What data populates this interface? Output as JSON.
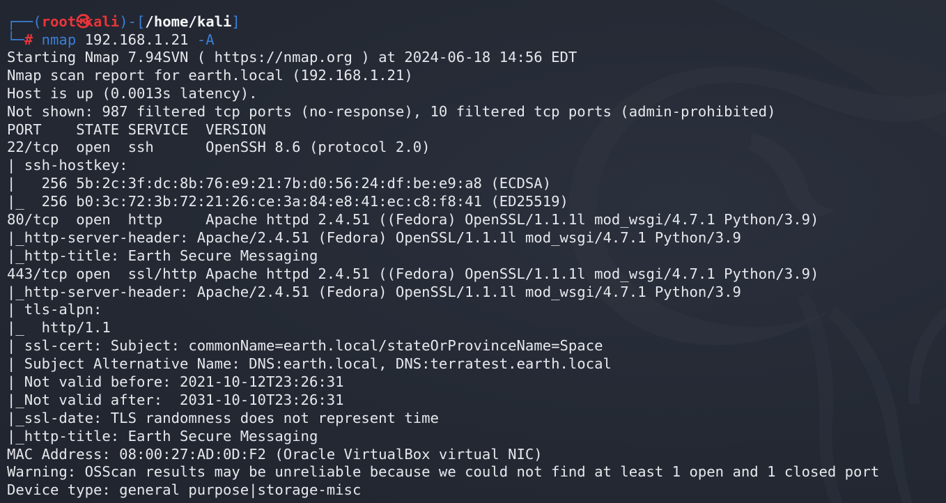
{
  "prompt": {
    "bracket_open_top": "┌──(",
    "user": "root",
    "symbol": "㉿",
    "host": "kali",
    "mid": ")-[",
    "cwd": "/home/kali",
    "bracket_close": "]",
    "corner_bottom": "└─",
    "hash": "#",
    "command": "nmap",
    "target": "192.168.1.21",
    "flag": "-A"
  },
  "output_lines": [
    "Starting Nmap 7.94SVN ( https://nmap.org ) at 2024-06-18 14:56 EDT",
    "Nmap scan report for earth.local (192.168.1.21)",
    "Host is up (0.0013s latency).",
    "Not shown: 987 filtered tcp ports (no-response), 10 filtered tcp ports (admin-prohibited)",
    "PORT    STATE SERVICE  VERSION",
    "22/tcp  open  ssh      OpenSSH 8.6 (protocol 2.0)",
    "| ssh-hostkey: ",
    "|   256 5b:2c:3f:dc:8b:76:e9:21:7b:d0:56:24:df:be:e9:a8 (ECDSA)",
    "|_  256 b0:3c:72:3b:72:21:26:ce:3a:84:e8:41:ec:c8:f8:41 (ED25519)",
    "80/tcp  open  http     Apache httpd 2.4.51 ((Fedora) OpenSSL/1.1.1l mod_wsgi/4.7.1 Python/3.9)",
    "|_http-server-header: Apache/2.4.51 (Fedora) OpenSSL/1.1.1l mod_wsgi/4.7.1 Python/3.9",
    "|_http-title: Earth Secure Messaging",
    "443/tcp open  ssl/http Apache httpd 2.4.51 ((Fedora) OpenSSL/1.1.1l mod_wsgi/4.7.1 Python/3.9)",
    "|_http-server-header: Apache/2.4.51 (Fedora) OpenSSL/1.1.1l mod_wsgi/4.7.1 Python/3.9",
    "| tls-alpn: ",
    "|_  http/1.1",
    "| ssl-cert: Subject: commonName=earth.local/stateOrProvinceName=Space",
    "| Subject Alternative Name: DNS:earth.local, DNS:terratest.earth.local",
    "| Not valid before: 2021-10-12T23:26:31",
    "|_Not valid after:  2031-10-10T23:26:31",
    "|_ssl-date: TLS randomness does not represent time",
    "|_http-title: Earth Secure Messaging",
    "MAC Address: 08:00:27:AD:0D:F2 (Oracle VirtualBox virtual NIC)",
    "Warning: OSScan results may be unreliable because we could not find at least 1 open and 1 closed port",
    "Device type: general purpose|storage-misc"
  ],
  "colors": {
    "background": "#232733",
    "text": "#e6e8ec",
    "prompt_blue": "#3a7fd6",
    "prompt_red": "#e8353a"
  }
}
